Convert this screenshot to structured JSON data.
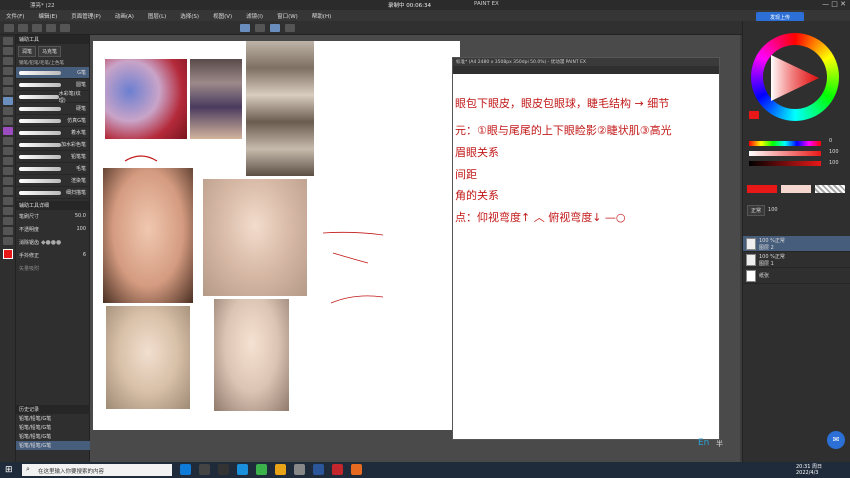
{
  "title_bar": {
    "doc_label": "漂亮* (22",
    "recording": "录制中 00:06:34",
    "app_name": "PAINT EX"
  },
  "menu": [
    "文件(F)",
    "编辑(E)",
    "页面管理(P)",
    "动画(A)",
    "图层(L)",
    "选择(S)",
    "视图(V)",
    "滤镜(I)",
    "窗口(W)",
    "帮助(H)"
  ],
  "cloud_button": "发现上传",
  "sub_tool_panel": {
    "header": "辅助工具",
    "tabs": [
      "润笔",
      "马克笔"
    ],
    "group_label": "钢笔/铅笔/毛笔/上色笔",
    "brushes": [
      "G笔",
      "圆笔",
      "水彩笔(纹理)",
      "硬笔",
      "仿真G笔",
      "着水笔",
      "加水彩色笔",
      "铅笔笔",
      "毛笔",
      "渲染笔",
      "细扫描笔"
    ],
    "tool_prop_header": "辅助工具详细",
    "brush_size_label": "笔刷尺寸",
    "brush_size_value": "50.0",
    "opacity_label": "不透明度",
    "opacity_value": "100",
    "anti_alias_label": "消除锯齿",
    "stabilization_label": "手抖修正",
    "stabilization_value": "6",
    "vector_label": "矢量吸附",
    "history_header": "历史记录",
    "history": [
      "铅笔/铅笔/G笔",
      "铅笔/铅笔/G笔",
      "铅笔/铅笔/G笔",
      "铅笔/铅笔/G笔"
    ]
  },
  "doc_window": {
    "title": "标准* (A4 2480 x 3508px 350dpi 50.0%) - 优动漫 PAINT EX",
    "notes": [
      "眼包下眼皮，眼皮包眼球，睫毛结构 → 细节",
      "元：①眼与尾尾的上下眼睑影②睫状肌③高光",
      "眉眼关系",
      "间距",
      "角的关系",
      "点：仰视弯度↑ ︿  俯视弯度↓ —○"
    ]
  },
  "colors": {
    "main": "#e81818",
    "sub": "#f5d7cf",
    "accent": "#c21818"
  },
  "right_panel": {
    "values": [
      "0",
      "100",
      "100"
    ],
    "blend_mode": "正常",
    "opacity": "100",
    "layers": [
      {
        "pct": "100 %正常",
        "name": "图层 2"
      },
      {
        "pct": "100 %正常",
        "name": "图层 1"
      },
      {
        "pct": "",
        "name": "纸张"
      }
    ]
  },
  "taskbar": {
    "search_placeholder": "在这里输入你要搜索的内容",
    "time": "20:31 周日",
    "date": "2022/4/3",
    "ime": "En",
    "ime2": "半"
  }
}
